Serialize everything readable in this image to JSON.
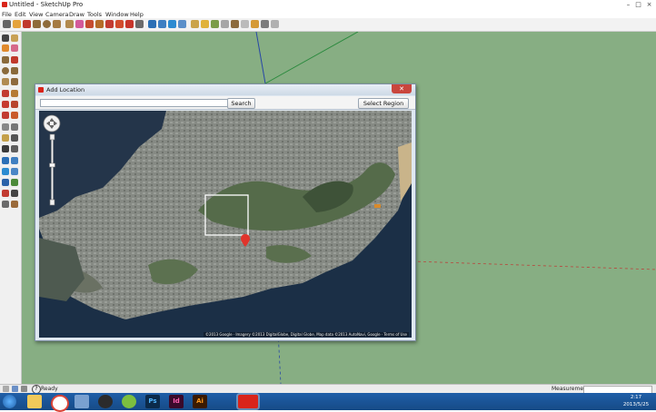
{
  "window": {
    "title": "Untitled - SketchUp Pro"
  },
  "menu": [
    "File",
    "Edit",
    "View",
    "Camera",
    "Draw",
    "Tools",
    "Window",
    "Help"
  ],
  "dialog": {
    "title": "Add Location",
    "search_value": "",
    "search_button": "Search",
    "select_region_button": "Select Region",
    "map": {
      "attribution": "©2013 Google · Imagery ©2013 DigitalGlobe, Digital Globe, Map data ©2013 AutoNavi, Google · Terms of Use"
    }
  },
  "status": {
    "text": "Ready",
    "measurements_label": "Measurements",
    "measurements_value": ""
  },
  "taskbar": {
    "apps": [
      {
        "name": "windows-explorer-icon",
        "label": ""
      },
      {
        "name": "chrome-icon",
        "label": ""
      },
      {
        "name": "app-icon",
        "label": ""
      },
      {
        "name": "qq-icon",
        "label": ""
      },
      {
        "name": "app-icon-2",
        "label": ""
      },
      {
        "name": "photoshop-icon",
        "label": "Ps"
      },
      {
        "name": "indesign-icon",
        "label": "Id"
      },
      {
        "name": "illustrator-icon",
        "label": "Ai"
      },
      {
        "name": "sketchup-icon",
        "label": ""
      }
    ],
    "clock_time": "2:17",
    "clock_date": "2013/5/25"
  },
  "colors": {
    "viewport_bg": "#87ae83",
    "accent_red": "#d9241a",
    "taskbar": "#1f5fa8"
  }
}
